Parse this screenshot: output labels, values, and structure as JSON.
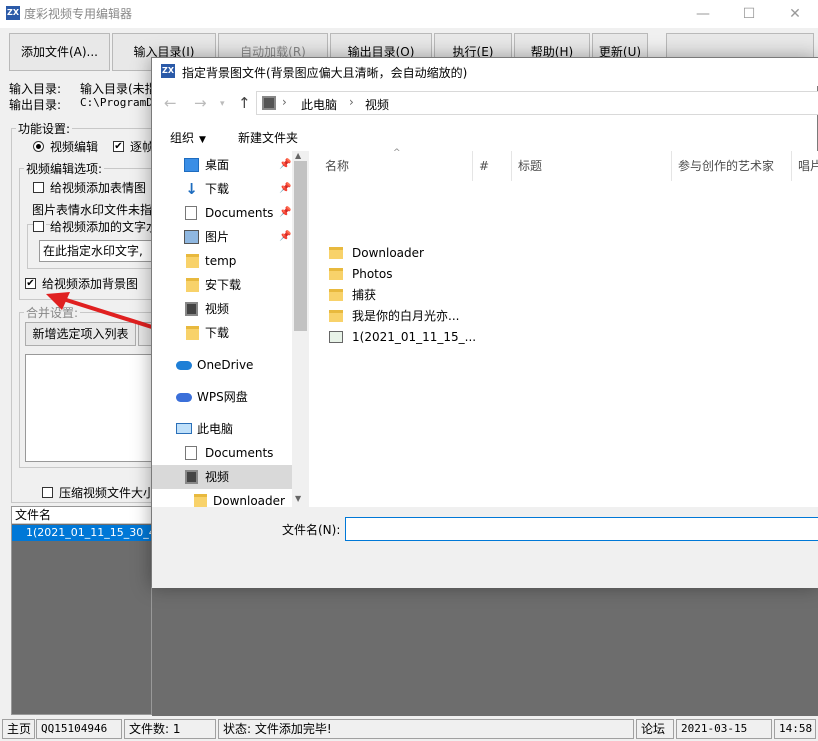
{
  "main": {
    "title": "度彩视频专用编辑器",
    "toolbar": [
      "添加文件(A)...",
      "输入目录(I)",
      "自动加载(R)",
      "输出目录(O)",
      "执行(E)",
      "帮助(H)",
      "更新(U)"
    ],
    "input_dir_label": "输入目录:",
    "input_dir_value": "输入目录(未指",
    "output_dir_label": "输出目录:",
    "output_dir_value": "C:\\ProgramDa",
    "function_settings": "功能设置:",
    "radio_video_edit": "视频编辑",
    "check_frame": "逐帧",
    "video_edit_options": "视频编辑选项:",
    "check_add_emoji": "给视频添加表情图",
    "watermark_note": "图片表情水印文件未指",
    "check_text_watermark": "给视频添加的文字水",
    "watermark_placeholder": "在此指定水印文字,",
    "check_background": "给视频添加背景图",
    "merge_settings": "合并设置:",
    "add_selected_btn": "新增选定项入列表",
    "check_compress": "压缩视频文件大小",
    "file_list_header": "文件名",
    "file_list_row": "1(2021_01_11_15_30_48"
  },
  "dialog": {
    "title": "指定背景图文件(背景图应偏大且清晰，会自动缩放的)",
    "breadcrumb": [
      "此电脑",
      "视频"
    ],
    "organize": "组织",
    "new_folder": "新建文件夹",
    "nav_items": [
      {
        "label": "桌面",
        "icon": "desktop-icon",
        "pinned": true
      },
      {
        "label": "下载",
        "icon": "download-icon",
        "pinned": true
      },
      {
        "label": "Documents",
        "icon": "document-icon",
        "pinned": true
      },
      {
        "label": "图片",
        "icon": "picture-icon",
        "pinned": true
      },
      {
        "label": "temp",
        "icon": "folder-icon",
        "pinned": false
      },
      {
        "label": "安下载",
        "icon": "folder-icon",
        "pinned": false
      },
      {
        "label": "视频",
        "icon": "video-icon",
        "pinned": false
      },
      {
        "label": "下载",
        "icon": "folder-icon",
        "pinned": false
      },
      {
        "label": "OneDrive",
        "icon": "cloud-icon",
        "pinned": false
      },
      {
        "label": "WPS网盘",
        "icon": "cloud-icon",
        "pinned": false
      },
      {
        "label": "此电脑",
        "icon": "computer-icon",
        "pinned": false
      },
      {
        "label": "Documents",
        "icon": "document-icon",
        "pinned": false
      },
      {
        "label": "视频",
        "icon": "video-icon",
        "pinned": false
      },
      {
        "label": "Downloader",
        "icon": "folder-icon",
        "pinned": false
      }
    ],
    "columns": [
      "名称",
      "#",
      "标题",
      "参与创作的艺术家",
      "唱片"
    ],
    "files": [
      {
        "name": "Downloader",
        "type": "folder"
      },
      {
        "name": "Photos",
        "type": "folder"
      },
      {
        "name": "捕获",
        "type": "folder"
      },
      {
        "name": "我是你的白月光亦...",
        "type": "folder"
      },
      {
        "name": "1(2021_01_11_15_...",
        "type": "video"
      }
    ],
    "filename_label": "文件名(N):",
    "filename_value": ""
  },
  "statusbar": {
    "home": "主页",
    "qq": "QQ15104946",
    "file_count": "文件数: 1",
    "status": "状态: 文件添加完毕!",
    "forum": "论坛",
    "date": "2021-03-15",
    "time": "14:58"
  },
  "colors": {
    "accent": "#0078d7",
    "arrow": "#e02020",
    "folder": "#f8d26a"
  }
}
